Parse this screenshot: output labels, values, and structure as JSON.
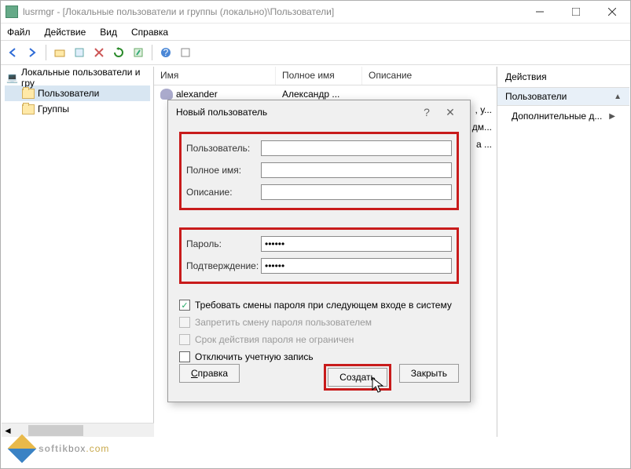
{
  "window": {
    "title": "lusrmgr - [Локальные пользователи и группы (локально)\\Пользователи]"
  },
  "menu": {
    "file": "Файл",
    "action": "Действие",
    "view": "Вид",
    "help": "Справка"
  },
  "tree": {
    "root": "Локальные пользователи и гру",
    "users": "Пользователи",
    "groups": "Группы"
  },
  "table": {
    "col_name": "Имя",
    "col_fullname": "Полное имя",
    "col_desc": "Описание",
    "rows": [
      {
        "name": "alexander",
        "full": "Александр ...",
        "desc": ""
      }
    ],
    "peek1": ", у...",
    "peek2": "дм...",
    "peek3": "а ..."
  },
  "actions": {
    "header": "Действия",
    "band": "Пользователи",
    "more": "Дополнительные д..."
  },
  "dialog": {
    "title": "Новый пользователь",
    "lbl_user": "Пользователь:",
    "lbl_full": "Полное имя:",
    "lbl_desc": "Описание:",
    "lbl_pass": "Пароль:",
    "lbl_conf": "Подтверждение:",
    "val_pass": "••••••",
    "val_conf": "••••••",
    "chk_mustchange": "Требовать смены пароля при следующем входе в систему",
    "chk_nochange": "Запретить смену пароля пользователем",
    "chk_noexpire": "Срок действия пароля не ограничен",
    "chk_disabled": "Отключить учетную запись",
    "btn_help": "Справка",
    "btn_create": "Создать",
    "btn_close": "Закрыть",
    "help_q": "?"
  },
  "watermark": {
    "a": "softik",
    "b": "box",
    "c": ".com"
  }
}
